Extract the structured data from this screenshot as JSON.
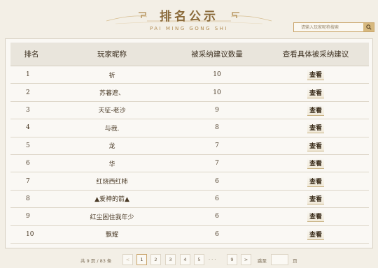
{
  "header": {
    "title": "排名公示",
    "subtitle": "PAI MING GONG SHI",
    "search_placeholder": "请输入玩家昵称搜索"
  },
  "table": {
    "columns": [
      "排名",
      "玩家昵称",
      "被采纳建议数量",
      "查看具体被采纳建议"
    ],
    "rows": [
      {
        "rank": "1",
        "name": "祈",
        "count": "10",
        "action": "查看"
      },
      {
        "rank": "2",
        "name": "苏暮遮、",
        "count": "10",
        "action": "查看"
      },
      {
        "rank": "3",
        "name": "天征-老沙",
        "count": "9",
        "action": "查看"
      },
      {
        "rank": "4",
        "name": "与我.",
        "count": "8",
        "action": "查看"
      },
      {
        "rank": "5",
        "name": "龙",
        "count": "7",
        "action": "查看"
      },
      {
        "rank": "6",
        "name": "华",
        "count": "7",
        "action": "查看"
      },
      {
        "rank": "7",
        "name": "红烧西红柿",
        "count": "6",
        "action": "查看"
      },
      {
        "rank": "8",
        "name": "▲爱神的箭▲",
        "count": "6",
        "action": "查看"
      },
      {
        "rank": "9",
        "name": "红尘困住我年少",
        "count": "6",
        "action": "查看"
      },
      {
        "rank": "10",
        "name": "飘耀",
        "count": "6",
        "action": "查看"
      }
    ]
  },
  "pagination": {
    "summary": "共 9 页 / 83 条",
    "prev": "<",
    "pages": [
      "1",
      "2",
      "3",
      "4",
      "5"
    ],
    "ellipsis": "· · ·",
    "last": "9",
    "next": ">",
    "jump_label": "跳至",
    "page_unit": "页",
    "current": "1"
  }
}
